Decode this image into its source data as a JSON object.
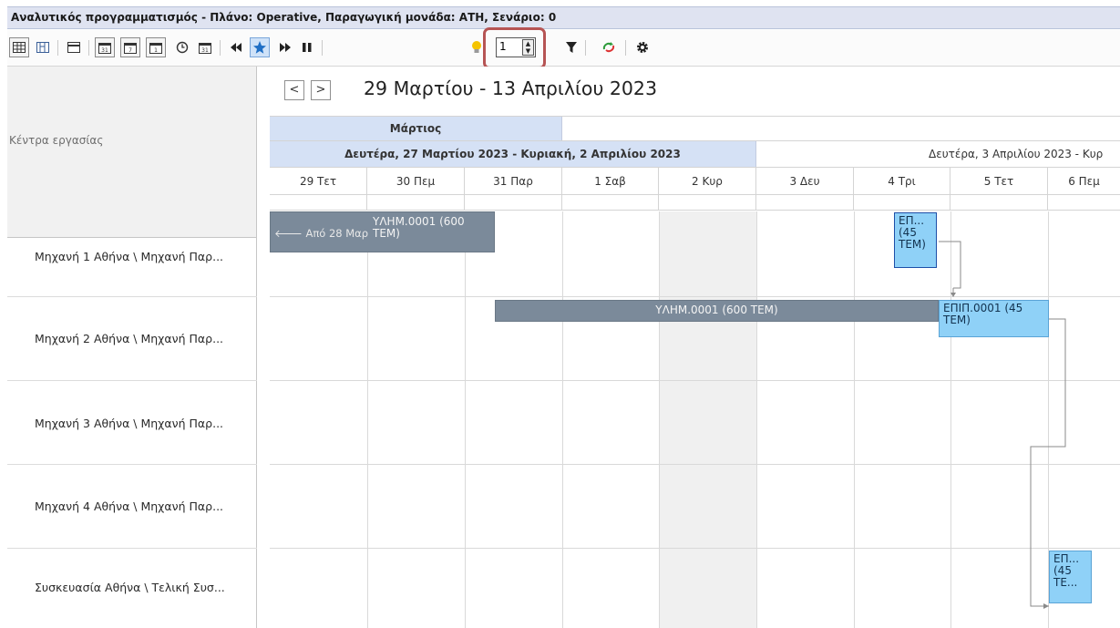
{
  "window": {
    "title": "Αναλυτικός προγραμματισμός - Πλάνο: Operative, Παραγωγική μονάδα: ΑΤΗ, Σενάριο: 0"
  },
  "toolbar": {
    "buttons": [
      {
        "icon": "grid-view-icon"
      },
      {
        "icon": "split-view-icon"
      },
      {
        "icon": "list-view-icon"
      },
      {
        "icon": "calendar-day-icon"
      },
      {
        "icon": "calendar-week-icon"
      },
      {
        "icon": "calendar-month-icon"
      },
      {
        "icon": "clock-icon"
      },
      {
        "icon": "calendar-today-icon"
      },
      {
        "icon": "rewind-icon"
      },
      {
        "icon": "star-icon"
      },
      {
        "icon": "fast-forward-icon"
      },
      {
        "icon": "pause-icon"
      },
      {
        "icon": "lightbulb-icon"
      },
      {
        "icon": "filter-icon"
      },
      {
        "icon": "refresh-icon"
      },
      {
        "icon": "settings-icon"
      }
    ],
    "spinner_value": "1"
  },
  "left_panel": {
    "header": "Κέντρα εργασίας",
    "resources": [
      "Μηχανή 1 Αθήνα \\ Μηχανή Παρ...",
      "Μηχανή 2 Αθήνα \\ Μηχανή Παρ...",
      "Μηχανή 3 Αθήνα \\ Μηχανή Παρ...",
      "Μηχανή 4 Αθήνα \\ Μηχανή Παρ...",
      "Συσκευασία Αθήνα \\ Τελική Συσ..."
    ]
  },
  "scheduler": {
    "nav_prev": "<",
    "nav_next": ">",
    "date_range": "29 Μαρτίου - 13 Απριλίου 2023",
    "month": "Μάρτιος",
    "week1": "Δευτέρα, 27 Μαρτίου 2023 - Κυριακή, 2 Απριλίου 2023",
    "week2": "Δευτέρα, 3 Απριλίου 2023 - Κυρ",
    "days": [
      "29 Τετ",
      "30 Πεμ",
      "31 Παρ",
      "1 Σαβ",
      "2 Κυρ",
      "3 Δευ",
      "4 Τρι",
      "5 Τετ",
      "6 Πεμ"
    ],
    "appointments": {
      "a1_from": "🡐 Από 28 Μαρ",
      "a1_text": "ΥΛΗΜ.0001 (600 ΤΕΜ)",
      "a2_text": "ΕΠ... (45 ΤΕΜ)",
      "a3_text": "ΥΛΗΜ.0001 (600 ΤΕΜ)",
      "a4_text": "ΕΠΙΠ.0001 (45 ΤΕΜ)",
      "a5_text": "ΕΠ... (45 ΤΕ..."
    }
  },
  "colors": {
    "header_blue": "#d5e1f5",
    "bar_gray": "#7b8a9a",
    "bar_blue": "#8fd1f7",
    "highlight": "#b65454"
  }
}
